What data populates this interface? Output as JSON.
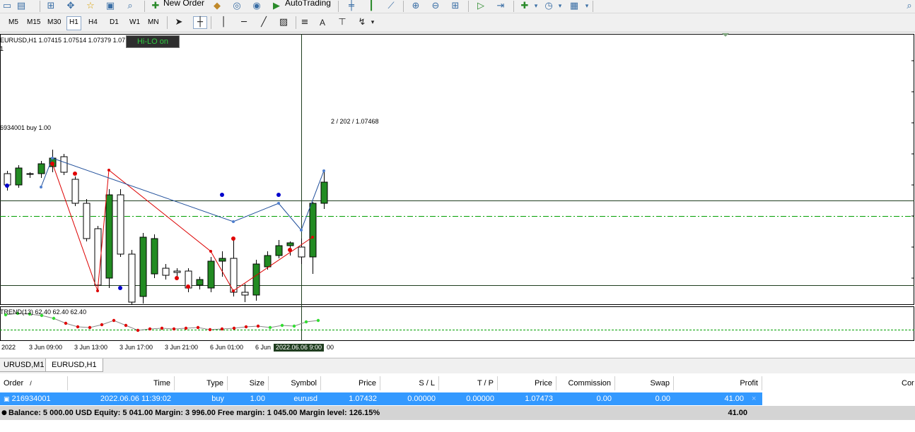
{
  "toolbar": {
    "new_order_label": "New Order",
    "auto_trading_label": "AutoTrading"
  },
  "timeframes": [
    {
      "label": "M5",
      "active": false
    },
    {
      "label": "M15",
      "active": false
    },
    {
      "label": "M30",
      "active": false
    },
    {
      "label": "H1",
      "active": true
    },
    {
      "label": "H4",
      "active": false
    },
    {
      "label": "D1",
      "active": false
    },
    {
      "label": "W1",
      "active": false
    },
    {
      "label": "MN",
      "active": false
    }
  ],
  "chart": {
    "header": "EURUSD,H1  1.07415 1.07514 1.07379 1.07",
    "header_line2": "1",
    "hilo_button": "Hi-LO on",
    "order_line_label": "6934001 buy 1.00",
    "crosshair_label": "2 / 202 / 1.07468",
    "indicator_label": "TREND(13) 62.40 62.40 62.40",
    "time_labels": [
      "2022",
      "3 Jun 09:00",
      "3 Jun 13:00",
      "3 Jun 17:00",
      "3 Jun 21:00",
      "6 Jun 01:00",
      "6 Jun"
    ],
    "time_highlight": "2022.06.06 9:00",
    "time_after": "00",
    "colors": {
      "bull": "#228b22",
      "bear": "#ffffff",
      "zigzag_down": "#dd0000",
      "zigzag_up": "#1f4e9a",
      "level_line": "#00a000"
    }
  },
  "chart_data": {
    "type": "candlestick",
    "candles": [
      {
        "o": 38,
        "c": 22,
        "h": 42,
        "l": 14
      },
      {
        "o": 22,
        "c": 46,
        "h": 50,
        "l": 18
      },
      {
        "o": 38,
        "c": 38,
        "h": 40,
        "l": 32
      },
      {
        "o": 38,
        "c": 52,
        "h": 56,
        "l": 32
      },
      {
        "o": 48,
        "c": 60,
        "h": 72,
        "l": 40
      },
      {
        "o": 62,
        "c": 40,
        "h": 66,
        "l": 36
      },
      {
        "o": 30,
        "c": -4,
        "h": 34,
        "l": -8
      },
      {
        "o": -4,
        "c": -54,
        "h": 2,
        "l": -58
      },
      {
        "o": -40,
        "c": -120,
        "h": -36,
        "l": -130
      },
      {
        "o": -110,
        "c": 8,
        "h": 16,
        "l": -124
      },
      {
        "o": 8,
        "c": -76,
        "h": 16,
        "l": -80
      },
      {
        "o": -76,
        "c": -144,
        "h": -70,
        "l": -148
      },
      {
        "o": -136,
        "c": -52,
        "h": -46,
        "l": -146
      },
      {
        "o": -104,
        "c": -54,
        "h": -48,
        "l": -110
      },
      {
        "o": -96,
        "c": -106,
        "h": -90,
        "l": -112
      },
      {
        "o": -100,
        "c": -102,
        "h": -96,
        "l": -110
      },
      {
        "o": -100,
        "c": -124,
        "h": -96,
        "l": -130
      },
      {
        "o": -120,
        "c": -112,
        "h": -108,
        "l": -126
      },
      {
        "o": -124,
        "c": -86,
        "h": -80,
        "l": -130
      },
      {
        "o": -86,
        "c": -82,
        "h": -72,
        "l": -108
      },
      {
        "o": -82,
        "c": -130,
        "h": -52,
        "l": -136
      },
      {
        "o": -130,
        "c": -134,
        "h": -118,
        "l": -144
      },
      {
        "o": -134,
        "c": -90,
        "h": -84,
        "l": -142
      },
      {
        "o": -94,
        "c": -78,
        "h": -72,
        "l": -98
      },
      {
        "o": -78,
        "c": -64,
        "h": -56,
        "l": -82
      },
      {
        "o": -64,
        "c": -60,
        "h": -58,
        "l": -78
      },
      {
        "o": -66,
        "c": -80,
        "h": -54,
        "l": -90
      },
      {
        "o": -80,
        "c": -4,
        "h": -2,
        "l": -104
      },
      {
        "o": -4,
        "c": 26,
        "h": 44,
        "l": -12
      }
    ],
    "zigzag_down": [
      [
        4,
        53
      ],
      [
        8,
        -128
      ],
      [
        9,
        43
      ],
      [
        18,
        -72
      ],
      [
        20,
        -128
      ],
      [
        27,
        -52
      ]
    ],
    "zigzag_up": [
      [
        3,
        19
      ],
      [
        4,
        60
      ],
      [
        20,
        -30
      ],
      [
        24,
        -4
      ],
      [
        26,
        -42
      ],
      [
        28,
        42
      ]
    ],
    "red_dots": [
      [
        4,
        52
      ],
      [
        6,
        38
      ],
      [
        15,
        -110
      ],
      [
        16,
        -122
      ],
      [
        20,
        -54
      ],
      [
        25,
        -70
      ]
    ],
    "blue_dots": [
      [
        0,
        21
      ],
      [
        10,
        -124
      ],
      [
        19,
        8
      ],
      [
        24,
        8
      ]
    ],
    "indicator": [
      62,
      64,
      63,
      61,
      57,
      50,
      45,
      44,
      48,
      54,
      47,
      40,
      42,
      43,
      42,
      43,
      44,
      41,
      42,
      43,
      45,
      46,
      44,
      47,
      46,
      52,
      54
    ],
    "price_levels": {
      "horizontal_lines": [
        0.0,
        -120
      ],
      "dashdot_line": -22
    },
    "time_axis": [
      "2022",
      "3 Jun 09:00",
      "3 Jun 13:00",
      "3 Jun 17:00",
      "3 Jun 21:00",
      "6 Jun 01:00",
      "6 Jun",
      "2022.06.06 9:00"
    ]
  },
  "chart_tabs": [
    "URUSD,M1",
    "EURUSD,H1"
  ],
  "active_chart_tab": 1,
  "terminal": {
    "columns": [
      "Order",
      "/",
      "Time",
      "Type",
      "Size",
      "Symbol",
      "Price",
      "S / L",
      "T / P",
      "Price",
      "Commission",
      "Swap",
      "Profit",
      "Cor"
    ],
    "row": {
      "order": "216934001",
      "time": "2022.06.06 11:39:02",
      "type": "buy",
      "size": "1.00",
      "symbol": "eurusd",
      "price": "1.07432",
      "sl": "0.00000",
      "tp": "0.00000",
      "current_price": "1.07473",
      "commission": "0.00",
      "swap": "0.00",
      "profit": "41.00",
      "close": "×"
    },
    "balance_line": "Balance: 5 000.00 USD  Equity: 5 041.00  Margin: 3 996.00  Free margin: 1 045.00  Margin level: 126.15%",
    "total_profit": "41.00"
  }
}
